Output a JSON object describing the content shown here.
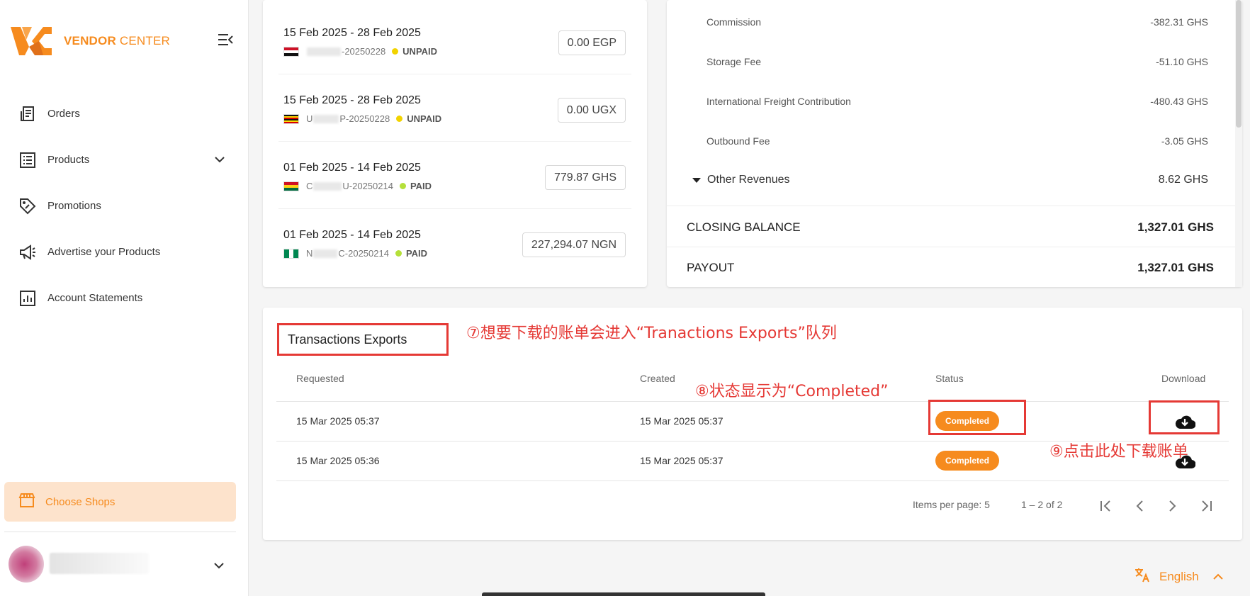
{
  "brand": {
    "name_bold": "VENDOR",
    "name_rest": "CENTER",
    "accent": "#f68b1e"
  },
  "sidebar": {
    "items": [
      {
        "label": "Orders",
        "icon": "receipt-icon"
      },
      {
        "label": "Products",
        "icon": "list-icon"
      },
      {
        "label": "Promotions",
        "icon": "tag-icon"
      },
      {
        "label": "Advertise your Products",
        "icon": "megaphone-icon"
      },
      {
        "label": "Account Statements",
        "icon": "chart-icon"
      }
    ],
    "choose_shops": "Choose Shops"
  },
  "statements": [
    {
      "dates": "15 Feb 2025 - 28 Feb 2025",
      "id_suffix": "-20250228",
      "status": "UNPAID",
      "amount": "0.00 EGP"
    },
    {
      "dates": "15 Feb 2025 - 28 Feb 2025",
      "id_prefix": "U",
      "id_suffix": "P-20250228",
      "status": "UNPAID",
      "amount": "0.00 UGX"
    },
    {
      "dates": "01 Feb 2025 - 14 Feb 2025",
      "id_prefix": "C",
      "id_suffix": "U-20250214",
      "status": "PAID",
      "amount": "779.87 GHS"
    },
    {
      "dates": "01 Feb 2025 - 14 Feb 2025",
      "id_prefix": "N",
      "id_suffix": "C-20250214",
      "status": "PAID",
      "amount": "227,294.07 NGN"
    }
  ],
  "balance": {
    "lines": [
      {
        "label": "Commission",
        "value": "-382.31 GHS"
      },
      {
        "label": "Storage Fee",
        "value": "-51.10 GHS"
      },
      {
        "label": "International Freight Contribution",
        "value": "-480.43 GHS"
      },
      {
        "label": "Outbound Fee",
        "value": "-3.05 GHS"
      }
    ],
    "other_revenues": {
      "label": "Other Revenues",
      "value": "8.62 GHS"
    },
    "closing": {
      "label": "CLOSING BALANCE",
      "value": "1,327.01 GHS"
    },
    "payout": {
      "label": "PAYOUT",
      "value": "1,327.01 GHS"
    }
  },
  "exports": {
    "title": "Transactions Exports",
    "columns": {
      "requested": "Requested",
      "created": "Created",
      "status": "Status",
      "download": "Download"
    },
    "rows": [
      {
        "requested": "15 Mar 2025 05:37",
        "created": "15 Mar 2025 05:37",
        "status": "Completed"
      },
      {
        "requested": "15 Mar 2025 05:36",
        "created": "15 Mar 2025 05:37",
        "status": "Completed"
      }
    ],
    "items_per_page": "Items per page: 5",
    "range": "1 – 2 of 2"
  },
  "annotations": {
    "a7": "⑦想要下载的账单会进入“Tranactions Exports”队列",
    "a8": "⑧状态显示为“Completed”",
    "a9": "⑨点击此处下载账单"
  },
  "language": "English"
}
